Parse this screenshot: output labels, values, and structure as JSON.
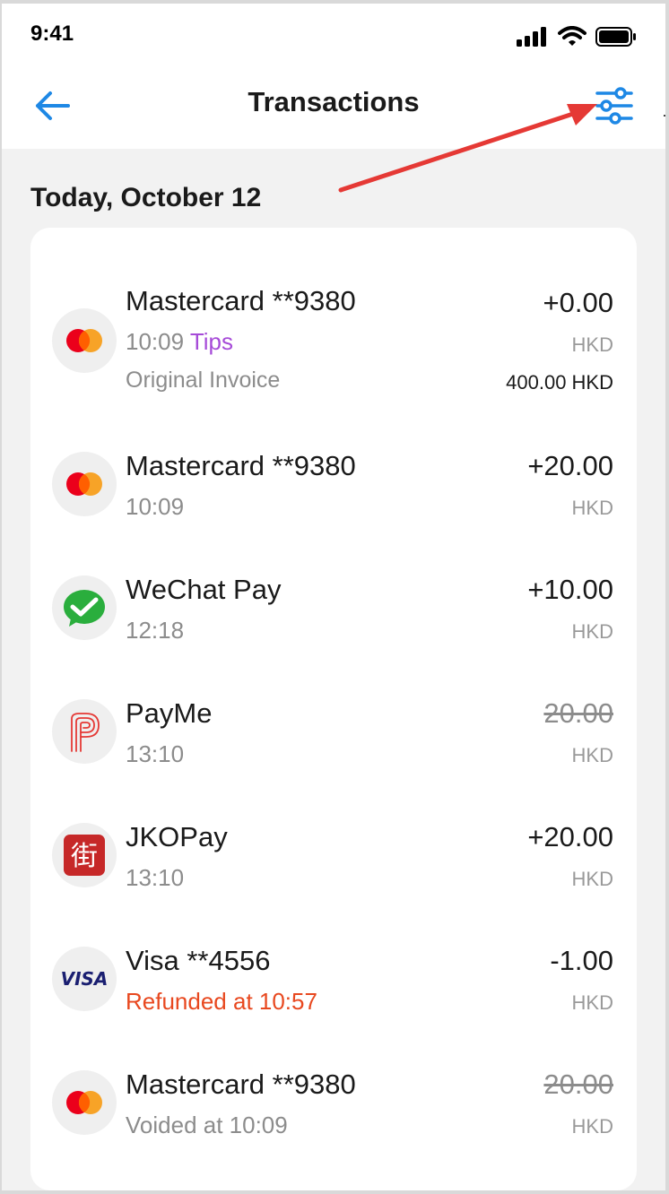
{
  "status_bar": {
    "time": "9:41"
  },
  "header": {
    "title": "Transactions"
  },
  "section": {
    "date_label": "Today, October 12"
  },
  "transactions": [
    {
      "method": "Mastercard **9380",
      "time": "10:09",
      "tag": "Tips",
      "note": "Original Invoice",
      "amount": "+0.00",
      "currency": "HKD",
      "original_amount": "400.00 HKD",
      "icon": "mastercard-icon"
    },
    {
      "method": "Mastercard **9380",
      "time": "10:09",
      "amount": "+20.00",
      "currency": "HKD",
      "icon": "mastercard-icon"
    },
    {
      "method": "WeChat Pay",
      "time": "12:18",
      "amount": "+10.00",
      "currency": "HKD",
      "icon": "wechat-pay-icon"
    },
    {
      "method": "PayMe",
      "time": "13:10",
      "amount": "20.00",
      "amount_struck": true,
      "currency": "HKD",
      "icon": "payme-icon"
    },
    {
      "method": "JKOPay",
      "time": "13:10",
      "amount": "+20.00",
      "currency": "HKD",
      "icon": "jkopay-icon"
    },
    {
      "method": "Visa **4556",
      "status": "Refunded at 10:57",
      "amount": "-1.00",
      "currency": "HKD",
      "icon": "visa-icon"
    },
    {
      "method": "Mastercard **9380",
      "status": "Voided at 10:09",
      "amount": "20.00",
      "amount_struck": true,
      "currency": "HKD",
      "icon": "mastercard-icon"
    }
  ],
  "colors": {
    "accent": "#1e88e5",
    "annotation_arrow": "#e53935",
    "tips_tag": "#a64bd8",
    "refund_status": "#e8481f",
    "mastercard_red": "#eb001b",
    "mastercard_orange": "#f79e1b",
    "wechat_green": "#2aae3d",
    "jkopay_red": "#c62828",
    "visa_blue": "#1a1f71"
  }
}
